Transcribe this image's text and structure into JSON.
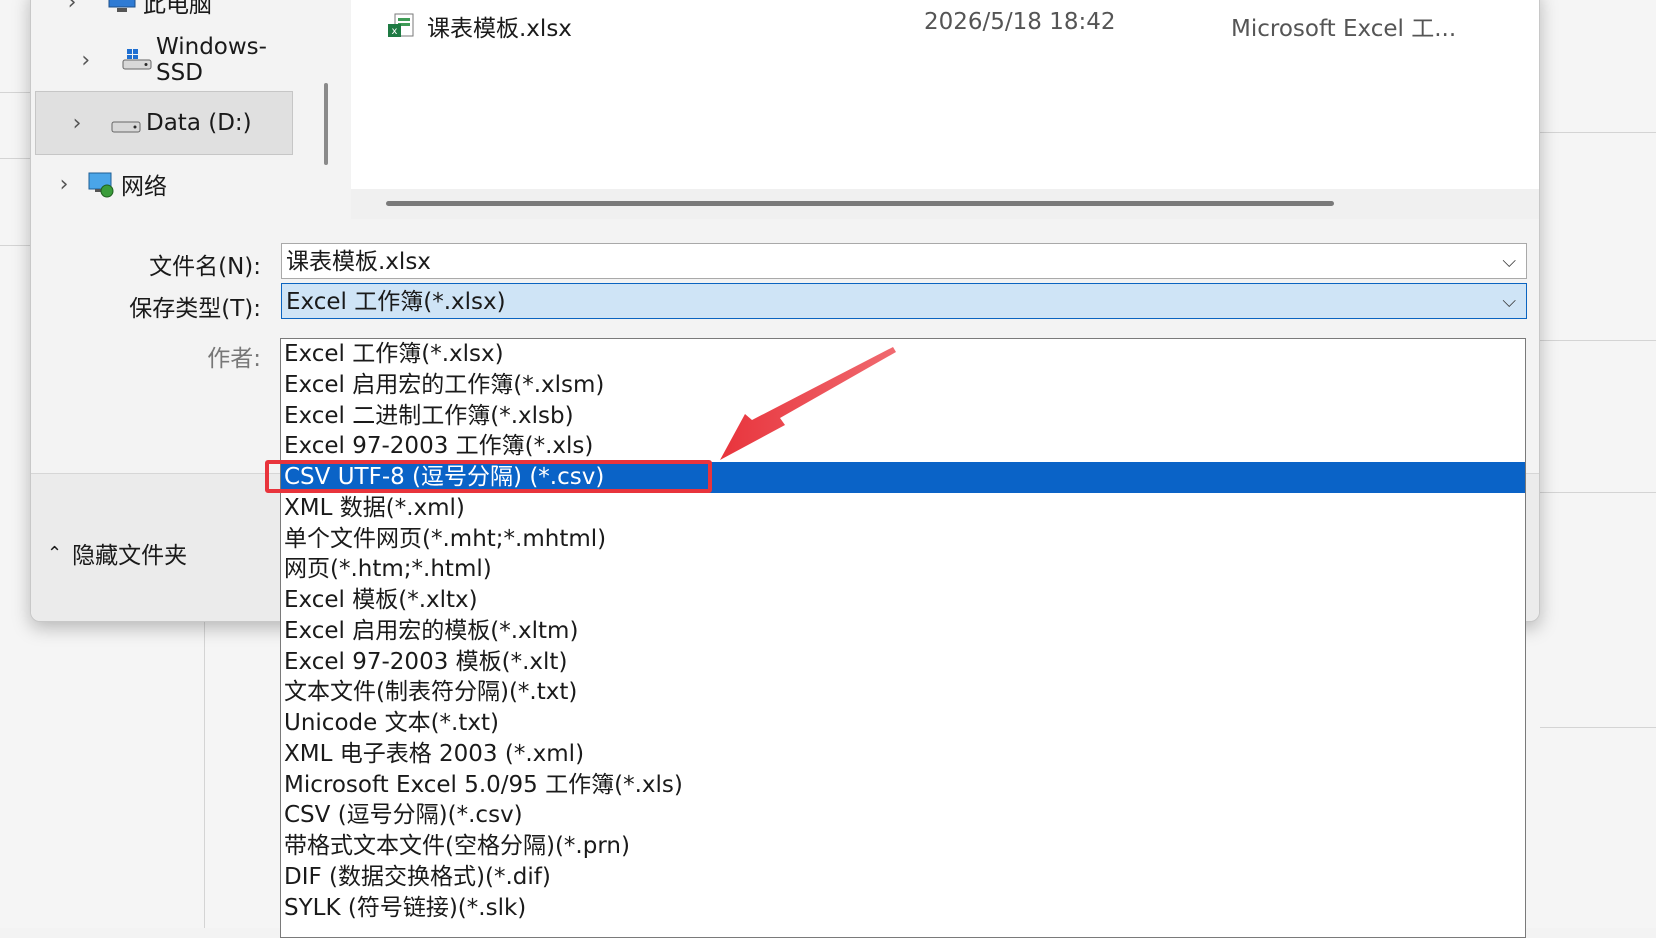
{
  "nav": {
    "items": [
      {
        "label": "此电脑",
        "icon": "computer-icon"
      },
      {
        "label": "Windows-SSD",
        "icon": "drive-icon"
      },
      {
        "label": "Data (D:)",
        "icon": "drive-icon"
      },
      {
        "label": "网络",
        "icon": "network-icon"
      }
    ]
  },
  "files": [
    {
      "name": "课表模板.xlsx",
      "date": "2026/5/18 18:42",
      "type": "Microsoft Excel 工..."
    }
  ],
  "form": {
    "filename_label": "文件名(N):",
    "filename_value": "课表模板.xlsx",
    "type_label": "保存类型(T):",
    "type_value": "Excel 工作簿(*.xlsx)",
    "author_label": "作者:"
  },
  "footer": {
    "hide_folders": "隐藏文件夹"
  },
  "dropdown": {
    "options": [
      "Excel 工作簿(*.xlsx)",
      "Excel 启用宏的工作簿(*.xlsm)",
      "Excel 二进制工作簿(*.xlsb)",
      "Excel 97-2003 工作簿(*.xls)",
      "CSV UTF-8 (逗号分隔) (*.csv)",
      "XML 数据(*.xml)",
      "单个文件网页(*.mht;*.mhtml)",
      "网页(*.htm;*.html)",
      "Excel 模板(*.xltx)",
      "Excel 启用宏的模板(*.xltm)",
      "Excel 97-2003 模板(*.xlt)",
      "文本文件(制表符分隔)(*.txt)",
      "Unicode 文本(*.txt)",
      "XML 电子表格 2003 (*.xml)",
      "Microsoft Excel 5.0/95 工作簿(*.xls)",
      "CSV (逗号分隔)(*.csv)",
      "带格式文本文件(空格分隔)(*.prn)",
      "DIF (数据交换格式)(*.dif)",
      "SYLK (符号链接)(*.slk)"
    ],
    "selected_index": 4
  },
  "colors": {
    "selection": "#0a63c7",
    "annotation": "#e8343c"
  }
}
